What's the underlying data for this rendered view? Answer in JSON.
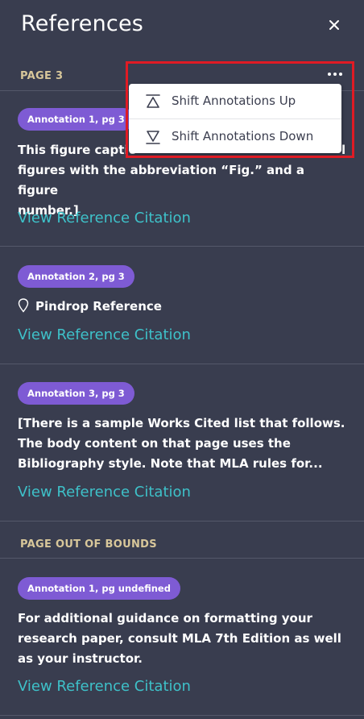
{
  "header": {
    "title": "References"
  },
  "sections": {
    "page3": {
      "label": "PAGE 3"
    },
    "out_of_bounds": {
      "label": "PAGE OUT OF BOUNDS"
    }
  },
  "menu": {
    "items": [
      {
        "label": "Shift Annotations Up",
        "icon": "shift-up-icon"
      },
      {
        "label": "Shift Annotations Down",
        "icon": "shift-down-icon"
      }
    ]
  },
  "annotations": [
    {
      "badge": "Annotation 1, pg 3",
      "text_lines": [
        "This figure captio",
        "figures with the abbreviation “Fig.” and a figure",
        "number.]"
      ],
      "text_hidden_right": "l",
      "link": "View Reference Citation"
    },
    {
      "badge": "Annotation 2, pg 3",
      "pin_label": "Pindrop Reference",
      "link": "View Reference Citation"
    },
    {
      "badge": "Annotation 3, pg 3",
      "text_lines": [
        "[There is a sample Works Cited list that follows.",
        "The body content on that page uses the",
        "Bibliography style. Note that MLA rules for..."
      ],
      "link": "View Reference Citation"
    },
    {
      "badge": "Annotation 1, pg undefined",
      "text_lines": [
        "For additional guidance on formatting your",
        "research paper, consult MLA 7th Edition as well",
        "as your instructor."
      ],
      "link": "View Reference Citation"
    }
  ],
  "colors": {
    "background": "#393d4f",
    "badge": "#7e5bd4",
    "link": "#3ec1c9",
    "section_label": "#d8c79a",
    "highlight": "#e01b24"
  }
}
